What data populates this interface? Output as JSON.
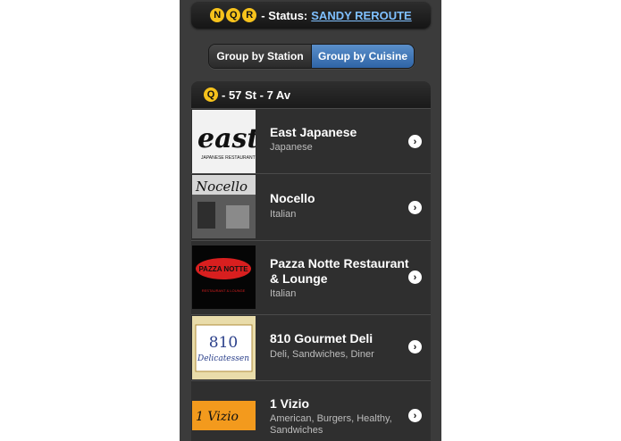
{
  "status": {
    "lines": [
      "N",
      "Q",
      "R"
    ],
    "label": "- Status:",
    "link": "SANDY REROUTE"
  },
  "group_toggle": {
    "station": "Group by Station",
    "cuisine": "Group by Cuisine",
    "selected": "cuisine"
  },
  "station": {
    "line": "Q",
    "name": "- 57 St - 7 Av"
  },
  "restaurants": [
    {
      "name": "East Japanese",
      "cuisine": "Japanese",
      "logo_text": "east",
      "logo_sub": "JAPANESE RESTAURANT"
    },
    {
      "name": "Nocello",
      "cuisine": "Italian",
      "logo_text": "Nocello"
    },
    {
      "name": "Pazza Notte Restaurant & Lounge",
      "cuisine": "Italian",
      "logo_text": "PAZZA NOTTE",
      "logo_sub": "RESTAURANT & LOUNGE"
    },
    {
      "name": "810 Gourmet Deli",
      "cuisine": "Deli, Sandwiches, Diner",
      "logo_text": "810",
      "logo_sub": "Delicatessen"
    },
    {
      "name": "1 Vizio",
      "cuisine": "American, Burgers, Healthy, Sandwiches",
      "logo_text": "1 Vizio"
    }
  ],
  "colors": {
    "line_yellow": "#f6c21c",
    "link_blue": "#7fc0ff",
    "selected_blue": "#3a73b6"
  },
  "icons": {
    "row_chevron": "chevron-right-icon"
  }
}
